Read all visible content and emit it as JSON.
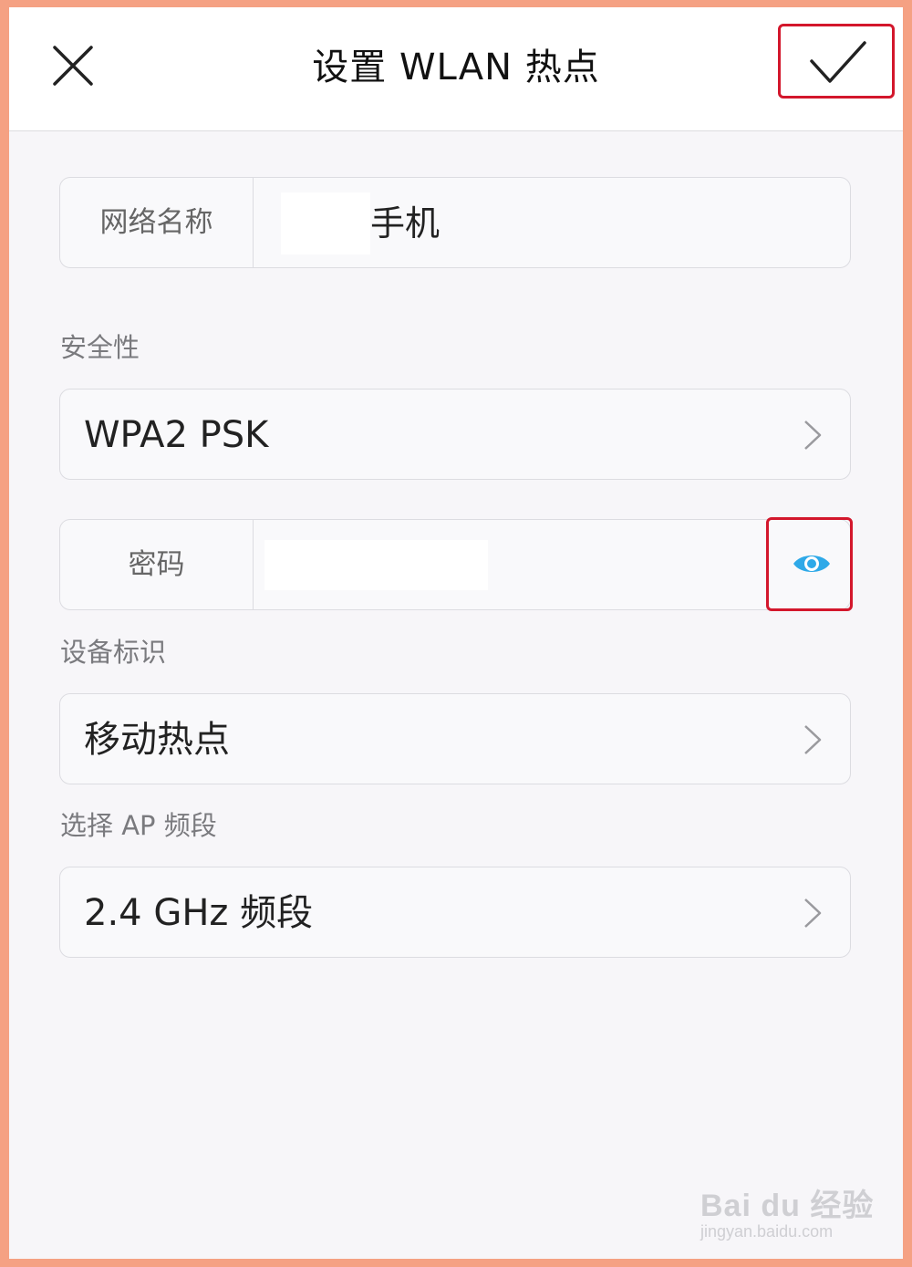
{
  "header": {
    "title": "设置 WLAN 热点",
    "close_icon": "close-icon",
    "confirm_icon": "check-icon"
  },
  "network_name": {
    "label": "网络名称",
    "value": "手机"
  },
  "security": {
    "section_label": "安全性",
    "value": "WPA2 PSK"
  },
  "password": {
    "label": "密码",
    "value": "",
    "toggle_icon": "eye-icon"
  },
  "device_id": {
    "section_label": "设备标识",
    "value": "移动热点"
  },
  "ap_band": {
    "section_label": "选择 AP 频段",
    "value": "2.4 GHz 频段"
  },
  "watermark": {
    "main": "Bai du 经验",
    "sub": "jingyan.baidu.com"
  },
  "colors": {
    "highlight_border": "#d3172c",
    "eye_icon": "#2ea9e8",
    "frame": "#f5a183"
  }
}
